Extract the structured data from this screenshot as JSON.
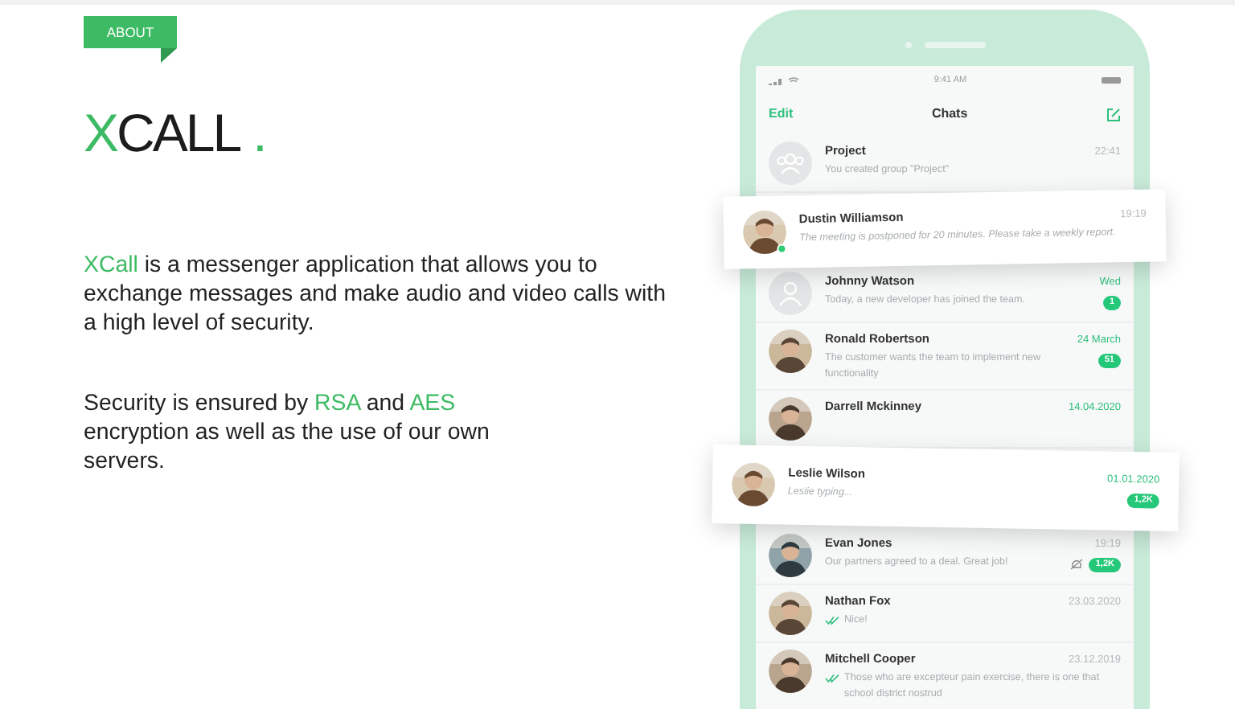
{
  "tag": "ABOUT",
  "logo": {
    "accent": "X",
    "rest": "CALL",
    "dot": "."
  },
  "paragraphs": [
    [
      {
        "text": "XCall",
        "accent": true
      },
      {
        "text": " is a messenger application that allows you to exchange messages and make audio and video calls with a high level of security.",
        "accent": false
      }
    ],
    [
      {
        "text": "Security is ensured by ",
        "accent": false
      },
      {
        "text": "RSA",
        "accent": true
      },
      {
        "text": " and ",
        "accent": false
      },
      {
        "text": "AES",
        "accent": true
      },
      {
        "text": " encryption as well as the use of our own servers.",
        "accent": false
      }
    ]
  ],
  "phone": {
    "status_time": "9:41 AM",
    "edit": "Edit",
    "title": "Chats",
    "chats": [
      {
        "name": "Project",
        "message": "You created group \"Project\"",
        "time": "22:41",
        "highlight": false,
        "floating": false,
        "kind": "group",
        "online": false,
        "muted": false,
        "ticks": false
      },
      {
        "name": "Dustin Williamson",
        "message": "The meeting is postponed for 20 minutes. Please take a weekly report.",
        "time": "19:19",
        "highlight": false,
        "floating": true,
        "online": true,
        "muted": false,
        "ticks": false
      },
      {
        "name": "Johnny Watson",
        "message": "Today, a new developer has joined the team.",
        "time": "Wed",
        "highlight": true,
        "floating": false,
        "kind": "person",
        "online": false,
        "muted": false,
        "ticks": false,
        "badge": "1"
      },
      {
        "name": "Ronald Robertson",
        "message": "The customer wants the team to implement new functionality",
        "time": "24 March",
        "highlight": true,
        "floating": false,
        "online": false,
        "muted": false,
        "ticks": false,
        "badge": "51"
      },
      {
        "name": "Darrell Mckinney",
        "time": "14.04.2020",
        "highlight": true,
        "floating": false,
        "online": false,
        "muted": false,
        "ticks": false
      },
      {
        "name": "Leslie Wilson",
        "message": "Leslie typing...",
        "time": "01.01.2020",
        "highlight": true,
        "floating": true,
        "online": false,
        "muted": false,
        "ticks": false,
        "badge": "1,2K"
      },
      {
        "name": "Evan Jones",
        "message": "Our partners agreed to a deal. Great job!",
        "time": "19:19",
        "highlight": false,
        "floating": false,
        "online": false,
        "muted": true,
        "ticks": false,
        "badge": "1,2K"
      },
      {
        "name": "Nathan Fox",
        "message": "Nice!",
        "time": "23.03.2020",
        "highlight": false,
        "floating": false,
        "online": false,
        "muted": false,
        "ticks": true
      },
      {
        "name": "Mitchell Cooper",
        "message": "Those who are excepteur pain exercise, there is one that school district nostrud",
        "time": "23.12.2019",
        "highlight": false,
        "floating": false,
        "online": false,
        "muted": false,
        "ticks": true
      }
    ]
  }
}
